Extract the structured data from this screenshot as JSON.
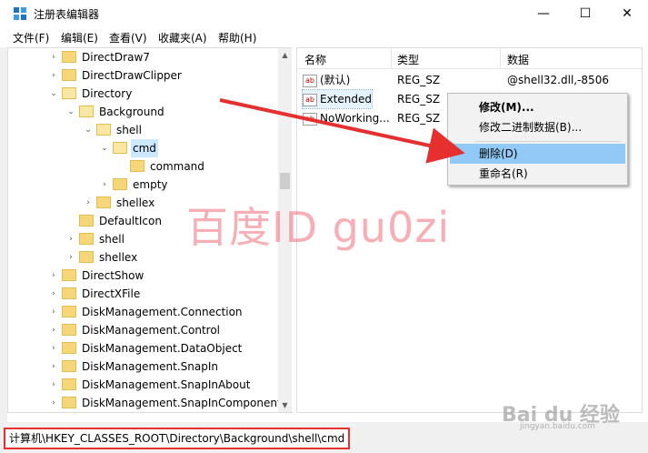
{
  "window": {
    "title": "注册表编辑器",
    "caption_min": "—",
    "caption_max": "☐",
    "caption_close": "✕"
  },
  "menubar": [
    "文件(F)",
    "编辑(E)",
    "查看(V)",
    "收藏夹(A)",
    "帮助(H)"
  ],
  "tree": [
    {
      "label": "DirectDraw7"
    },
    {
      "label": "DirectDrawClipper"
    },
    {
      "label": "Directory"
    },
    {
      "label": "Background"
    },
    {
      "label": "shell"
    },
    {
      "label": "cmd"
    },
    {
      "label": "command"
    },
    {
      "label": "empty"
    },
    {
      "label": "shellex"
    },
    {
      "label": "DefaultIcon"
    },
    {
      "label": "shell"
    },
    {
      "label": "shellex"
    },
    {
      "label": "DirectShow"
    },
    {
      "label": "DirectXFile"
    },
    {
      "label": "DiskManagement.Connection"
    },
    {
      "label": "DiskManagement.Control"
    },
    {
      "label": "DiskManagement.DataObject"
    },
    {
      "label": "DiskManagement.SnapIn"
    },
    {
      "label": "DiskManagement.SnapInAbout"
    },
    {
      "label": "DiskManagement.SnapInComponent"
    }
  ],
  "list": {
    "headers": {
      "name": "名称",
      "type": "类型",
      "data": "数据"
    },
    "icon_text": "ab",
    "rows": [
      {
        "name": "(默认)",
        "type": "REG_SZ",
        "data": "@shell32.dll,-8506"
      },
      {
        "name": "Extended",
        "type": "REG_SZ",
        "data": ""
      },
      {
        "name": "NoWorking...",
        "type": "REG_SZ",
        "data": ""
      }
    ]
  },
  "context_menu": {
    "items": [
      "修改(M)...",
      "修改二进制数据(B)...",
      "删除(D)",
      "重命名(R)"
    ],
    "highlighted_index": 2,
    "highlight_color": "#91c9f7"
  },
  "status": {
    "path": "计算机\\HKEY_CLASSES_ROOT\\Directory\\Background\\shell\\cmd",
    "outline_color": "#e62f2f"
  },
  "overlay": {
    "watermark": "百度ID gu0zi",
    "brand": "Bai du 经验",
    "brand_sub": "jingyan.baidu.com",
    "arrow_color": "#e62f2f"
  }
}
